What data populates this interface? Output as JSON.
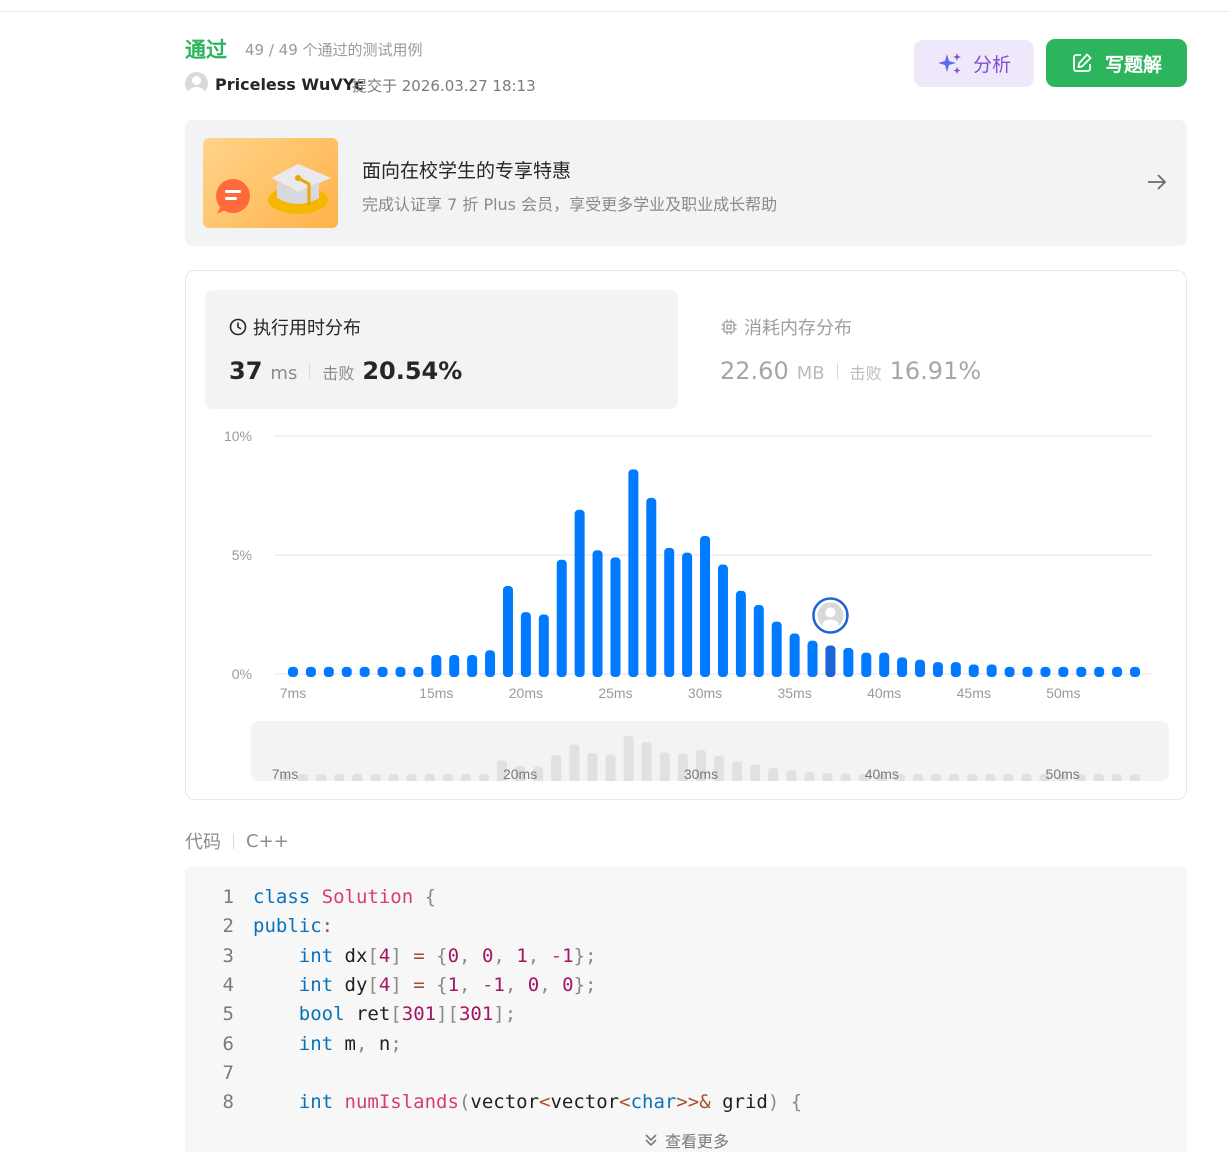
{
  "header": {
    "status": "通过",
    "tests": "49 / 49 个通过的测试用例",
    "username": "Priceless WuVYc",
    "submitted": "提交于 2026.03.27 18:13"
  },
  "actions": {
    "analyze_label": "分析",
    "write_label": "写题解"
  },
  "promo": {
    "title": "面向在校学生的专享特惠",
    "subtitle": "完成认证享 7 折 Plus 会员，享受更多学业及职业成长帮助"
  },
  "runtime": {
    "label": "执行用时分布",
    "value": "37",
    "unit": "ms",
    "beat_label": "击败",
    "beat_pct": "20.54%"
  },
  "memory": {
    "label": "消耗内存分布",
    "value": "22.60",
    "unit": "MB",
    "beat_label": "击败",
    "beat_pct": "16.91%"
  },
  "chart_data": {
    "type": "bar",
    "x": [
      7,
      8,
      9,
      10,
      11,
      12,
      13,
      14,
      15,
      16,
      17,
      18,
      19,
      20,
      21,
      22,
      23,
      24,
      25,
      26,
      27,
      28,
      29,
      30,
      31,
      32,
      33,
      34,
      35,
      36,
      37,
      38,
      39,
      40,
      41,
      42,
      43,
      44,
      45,
      46,
      47,
      48,
      49,
      50,
      51,
      52,
      53,
      54
    ],
    "values": [
      0.3,
      0.3,
      0.3,
      0.3,
      0.3,
      0.3,
      0.3,
      0.3,
      0.8,
      0.8,
      0.8,
      1.0,
      3.7,
      2.6,
      2.5,
      4.8,
      6.9,
      5.2,
      4.9,
      8.6,
      7.4,
      5.3,
      5.1,
      5.8,
      4.6,
      3.5,
      2.9,
      2.2,
      1.7,
      1.4,
      1.2,
      1.1,
      0.9,
      0.9,
      0.7,
      0.6,
      0.5,
      0.5,
      0.4,
      0.4,
      0.3,
      0.3,
      0.3,
      0.3,
      0.3,
      0.3,
      0.3,
      0.3
    ],
    "highlight_x": 37,
    "y_ticks": [
      "10%",
      "5%",
      "0%"
    ],
    "ylim": [
      0,
      10
    ],
    "x_ticks": [
      "7ms",
      "15ms",
      "20ms",
      "25ms",
      "30ms",
      "35ms",
      "40ms",
      "45ms",
      "50ms"
    ],
    "minimap_ticks": [
      "7ms",
      "20ms",
      "30ms",
      "40ms",
      "50ms"
    ],
    "colors": {
      "bar": "#007aff",
      "highlight": "#1d62d6",
      "grid": "#e6e6e6",
      "mini_bar": "#e1e1e1"
    }
  },
  "code": {
    "label": "代码",
    "language": "C++",
    "more_label": "查看更多",
    "lines": [
      {
        "n": "1",
        "tokens": [
          [
            "kw",
            "class"
          ],
          [
            "id",
            " "
          ],
          [
            "cls",
            "Solution"
          ],
          [
            "id",
            " "
          ],
          [
            "pun",
            "{"
          ]
        ]
      },
      {
        "n": "2",
        "tokens": [
          [
            "kw",
            "public"
          ],
          [
            "op",
            ":"
          ]
        ]
      },
      {
        "n": "3",
        "tokens": [
          [
            "id",
            "    "
          ],
          [
            "kw",
            "int"
          ],
          [
            "id",
            " dx"
          ],
          [
            "pun",
            "["
          ],
          [
            "num",
            "4"
          ],
          [
            "pun",
            "]"
          ],
          [
            "id",
            " "
          ],
          [
            "op",
            "="
          ],
          [
            "id",
            " "
          ],
          [
            "pun",
            "{"
          ],
          [
            "num",
            "0"
          ],
          [
            "pun",
            ","
          ],
          [
            "id",
            " "
          ],
          [
            "num",
            "0"
          ],
          [
            "pun",
            ","
          ],
          [
            "id",
            " "
          ],
          [
            "num",
            "1"
          ],
          [
            "pun",
            ","
          ],
          [
            "id",
            " "
          ],
          [
            "op",
            "-"
          ],
          [
            "num",
            "1"
          ],
          [
            "pun",
            "};"
          ]
        ]
      },
      {
        "n": "4",
        "tokens": [
          [
            "id",
            "    "
          ],
          [
            "kw",
            "int"
          ],
          [
            "id",
            " dy"
          ],
          [
            "pun",
            "["
          ],
          [
            "num",
            "4"
          ],
          [
            "pun",
            "]"
          ],
          [
            "id",
            " "
          ],
          [
            "op",
            "="
          ],
          [
            "id",
            " "
          ],
          [
            "pun",
            "{"
          ],
          [
            "num",
            "1"
          ],
          [
            "pun",
            ","
          ],
          [
            "id",
            " "
          ],
          [
            "op",
            "-"
          ],
          [
            "num",
            "1"
          ],
          [
            "pun",
            ","
          ],
          [
            "id",
            " "
          ],
          [
            "num",
            "0"
          ],
          [
            "pun",
            ","
          ],
          [
            "id",
            " "
          ],
          [
            "num",
            "0"
          ],
          [
            "pun",
            "};"
          ]
        ]
      },
      {
        "n": "5",
        "tokens": [
          [
            "id",
            "    "
          ],
          [
            "kw",
            "bool"
          ],
          [
            "id",
            " ret"
          ],
          [
            "pun",
            "["
          ],
          [
            "num",
            "301"
          ],
          [
            "pun",
            "]["
          ],
          [
            "num",
            "301"
          ],
          [
            "pun",
            "];"
          ]
        ]
      },
      {
        "n": "6",
        "tokens": [
          [
            "id",
            "    "
          ],
          [
            "kw",
            "int"
          ],
          [
            "id",
            " m"
          ],
          [
            "pun",
            ","
          ],
          [
            "id",
            " n"
          ],
          [
            "pun",
            ";"
          ]
        ]
      },
      {
        "n": "7",
        "tokens": []
      },
      {
        "n": "8",
        "tokens": [
          [
            "id",
            "    "
          ],
          [
            "kw",
            "int"
          ],
          [
            "id",
            " "
          ],
          [
            "fn",
            "numIslands"
          ],
          [
            "pun",
            "("
          ],
          [
            "id",
            "vector"
          ],
          [
            "op",
            "<"
          ],
          [
            "id",
            "vector"
          ],
          [
            "op",
            "<"
          ],
          [
            "kw",
            "char"
          ],
          [
            "op",
            ">>&"
          ],
          [
            "id",
            " grid"
          ],
          [
            "pun",
            ")"
          ],
          [
            "id",
            " "
          ],
          [
            "pun",
            "{"
          ]
        ]
      }
    ]
  }
}
